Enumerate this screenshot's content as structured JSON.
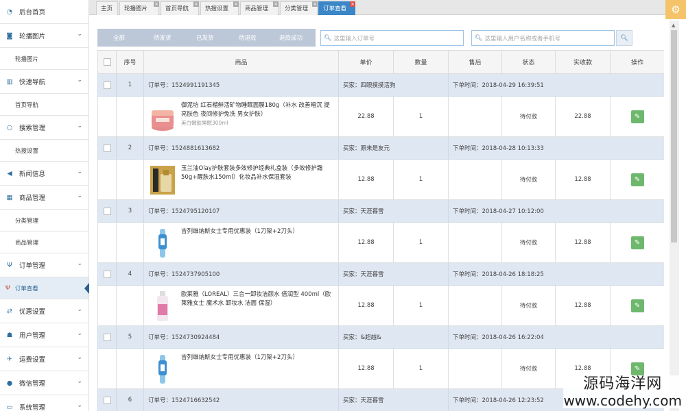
{
  "sidebar": {
    "items": [
      {
        "label": "后台首页",
        "icon": "dashboard-icon",
        "chevron": false
      },
      {
        "label": "轮播图片",
        "icon": "camera-icon",
        "chevron": true,
        "subs": [
          "轮播图片"
        ]
      },
      {
        "label": "快速导航",
        "icon": "barcode-icon",
        "chevron": true,
        "subs": [
          "首页导航"
        ]
      },
      {
        "label": "搜索管理",
        "icon": "circle-icon",
        "chevron": true,
        "subs": [
          "热搜设置"
        ]
      },
      {
        "label": "新闻信息",
        "icon": "megaphone-icon",
        "chevron": true
      },
      {
        "label": "商品管理",
        "icon": "gift-icon",
        "chevron": true,
        "subs": [
          "分类管理",
          "商品管理"
        ]
      },
      {
        "label": "订单管理",
        "icon": "fork-knife-icon",
        "chevron": true,
        "subs": [
          "订单查看"
        ]
      },
      {
        "label": "优惠设置",
        "icon": "exchange-icon",
        "chevron": true
      },
      {
        "label": "用户管理",
        "icon": "users-icon",
        "chevron": true
      },
      {
        "label": "运费设置",
        "icon": "plane-icon",
        "chevron": true
      },
      {
        "label": "微信管理",
        "icon": "chat-icon",
        "chevron": true
      },
      {
        "label": "系统管理",
        "icon": "monitor-icon",
        "chevron": true
      }
    ]
  },
  "tabs": [
    "主页",
    "轮播图片",
    "首页导航",
    "热搜设置",
    "商品管理",
    "分类管理",
    "订单查看"
  ],
  "status_filters": [
    "全部",
    "待发货",
    "已发货",
    "待退款",
    "退款成功"
  ],
  "search": {
    "order_placeholder": "这里输入订单号",
    "user_placeholder": "这里输入用户名称或者手机号"
  },
  "table": {
    "headers": [
      "序号",
      "商品",
      "单价",
      "数量",
      "售后",
      "状态",
      "实收款",
      "操作"
    ],
    "orders": [
      {
        "no": "1",
        "order_label": "订单号：1524991191345",
        "buyer": "买家：四眼摸摸活狗",
        "time": "下单时间：2018-04-29 16:39:51",
        "product": "御泥坊 红石榴鲜活矿物睡眠面膜180g（补水 改善暗沉 提亮肤色 夜间修护免洗 男女护肤）",
        "spec": "美白嫩肤睡眠300ml",
        "price": "22.88",
        "qty": "1",
        "status": "待付款",
        "paid": "22.88",
        "thumb": "jar"
      },
      {
        "no": "2",
        "order_label": "订单号：1524881613682",
        "buyer": "买家：原来是友元",
        "time": "下单时间：2018-04-28 10:13:33",
        "product": "玉兰油Olay护肤套装多效修护经典礼盒装（多效修护霜50g+醒肤水150ml）化妆品补水保湿套装",
        "spec": "",
        "price": "12.88",
        "qty": "1",
        "status": "待付款",
        "paid": "12.88",
        "thumb": "box"
      },
      {
        "no": "3",
        "order_label": "订单号：1524795120107",
        "buyer": "买家：天涯暮雪",
        "time": "下单时间：2018-04-27 10:12:00",
        "product": "吉列维纳斯女士专用优惠装（1刀架+2刀头）",
        "spec": "",
        "price": "12.88",
        "qty": "1",
        "status": "待付款",
        "paid": "12.88",
        "thumb": "razor"
      },
      {
        "no": "4",
        "order_label": "订单号：1524737905100",
        "buyer": "买家：天涯暮雪",
        "time": "下单时间：2018-04-26 18:18:25",
        "product": "欧莱雅（LOREAL）三合一卸妆洁颜水 倍润型 400ml（欧莱雅女士 魔术水 卸妆水 洁面 保湿）",
        "spec": "",
        "price": "12.88",
        "qty": "1",
        "status": "待付款",
        "paid": "12.88",
        "thumb": "bottle"
      },
      {
        "no": "5",
        "order_label": "订单号：1524730924484",
        "buyer": "买家：&超越&",
        "time": "下单时间：2018-04-26 16:22:04",
        "product": "吉列维纳斯女士专用优惠装（1刀架+2刀头）",
        "spec": "",
        "price": "12.88",
        "qty": "1",
        "status": "待付款",
        "paid": "12.88",
        "thumb": "razor"
      },
      {
        "no": "6",
        "order_label": "订单号：1524716632542",
        "buyer": "买家：天涯暮雪",
        "time": "下单时间：2018-04-26 12:23:52",
        "product": "",
        "spec": "",
        "price": "",
        "qty": "",
        "status": "",
        "paid": "",
        "thumb": ""
      }
    ]
  },
  "watermark": {
    "line1": "源码海洋网",
    "line2": "www.codehy.com"
  },
  "colors": {
    "accent": "#3a86c7",
    "status_bar": "#bcc8d8",
    "info_row": "#dfe7f2",
    "edit_button": "#6db86d",
    "gear": "#f5c46a"
  }
}
